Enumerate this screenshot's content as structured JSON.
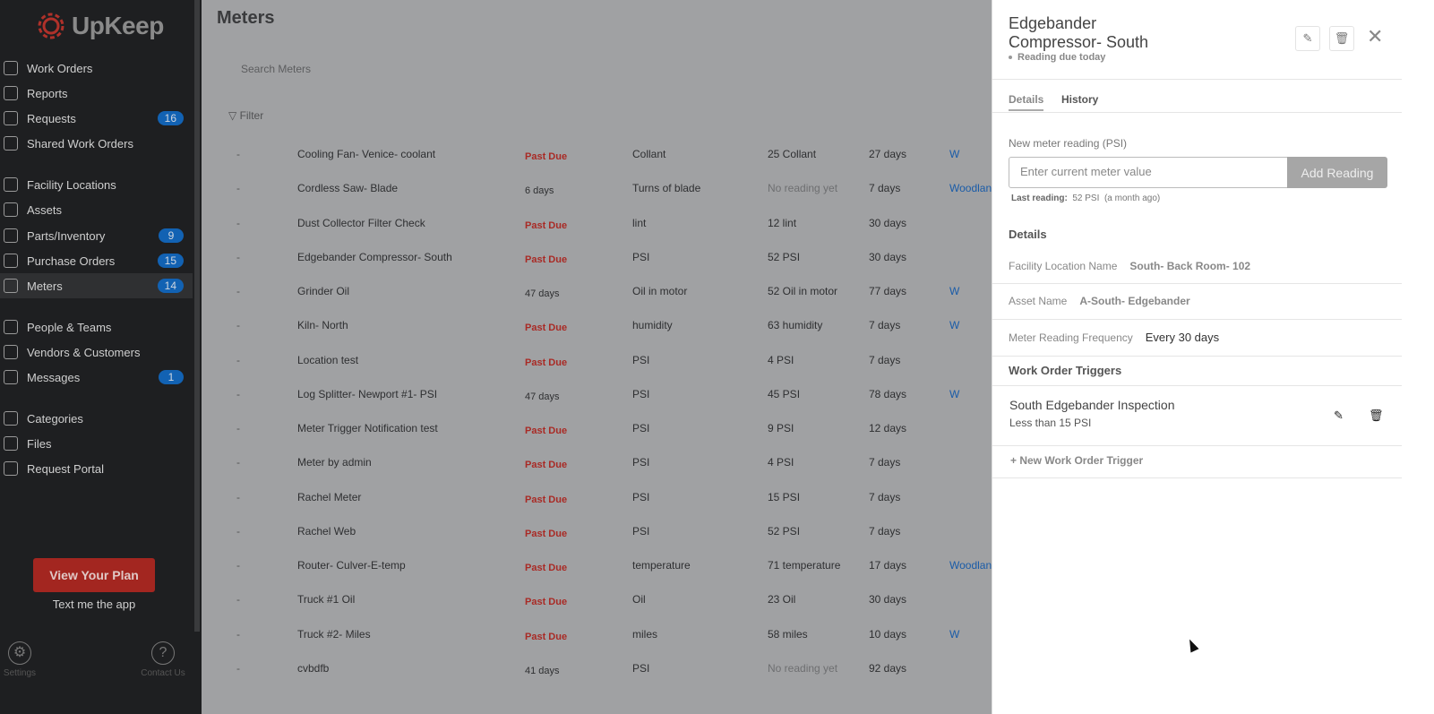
{
  "sidebar": {
    "brand": "UpKeep",
    "items": [
      {
        "label": "Work Orders"
      },
      {
        "label": "Reports"
      },
      {
        "label": "Requests",
        "badge": "16"
      },
      {
        "label": "Shared Work Orders"
      },
      {
        "label": "Facility Locations"
      },
      {
        "label": "Assets"
      },
      {
        "label": "Parts/Inventory",
        "badge": "9"
      },
      {
        "label": "Purchase Orders",
        "badge": "15"
      },
      {
        "label": "Meters",
        "badge": "14"
      },
      {
        "label": "People & Teams"
      },
      {
        "label": "Vendors & Customers"
      },
      {
        "label": "Messages",
        "badge": "1"
      },
      {
        "label": "Categories"
      },
      {
        "label": "Files"
      },
      {
        "label": "Request Portal"
      }
    ],
    "plan_button": "View Your Plan",
    "text_app": "Text me the app",
    "settings": "Settings",
    "contact": "Contact Us"
  },
  "main": {
    "title": "Meters",
    "search_placeholder": "Search Meters",
    "filter": "Filter",
    "rows": [
      {
        "dash": "-",
        "name": "Cooling Fan- Venice- coolant",
        "status": "Past Due",
        "unit": "Collant",
        "last": "25 Collant",
        "freq": "27 days",
        "loc": "W"
      },
      {
        "dash": "-",
        "name": "Cordless Saw- Blade",
        "status": "6 days",
        "unit": "Turns of blade",
        "last": "No reading yet",
        "freq": "7 days",
        "loc": "Woodlan"
      },
      {
        "dash": "-",
        "name": "Dust Collector Filter Check",
        "status": "Past Due",
        "unit": "lint",
        "last": "12 lint",
        "freq": "30 days",
        "loc": ""
      },
      {
        "dash": "-",
        "name": "Edgebander Compressor- South",
        "status": "Past Due",
        "unit": "PSI",
        "last": "52 PSI",
        "freq": "30 days",
        "loc": ""
      },
      {
        "dash": "-",
        "name": "Grinder Oil",
        "status": "47 days",
        "unit": "Oil in motor",
        "last": "52 Oil in motor",
        "freq": "77 days",
        "loc": "W"
      },
      {
        "dash": "-",
        "name": "Kiln- North",
        "status": "Past Due",
        "unit": "humidity",
        "last": "63 humidity",
        "freq": "7 days",
        "loc": "W"
      },
      {
        "dash": "-",
        "name": "Location test",
        "status": "Past Due",
        "unit": "PSI",
        "last": "4 PSI",
        "freq": "7 days",
        "loc": ""
      },
      {
        "dash": "-",
        "name": "Log Splitter- Newport #1- PSI",
        "status": "47 days",
        "unit": "PSI",
        "last": "45 PSI",
        "freq": "78 days",
        "loc": "W"
      },
      {
        "dash": "-",
        "name": "Meter Trigger Notification test",
        "status": "Past Due",
        "unit": "PSI",
        "last": "9 PSI",
        "freq": "12 days",
        "loc": ""
      },
      {
        "dash": "-",
        "name": "Meter by admin",
        "status": "Past Due",
        "unit": "PSI",
        "last": "4 PSI",
        "freq": "7 days",
        "loc": ""
      },
      {
        "dash": "-",
        "name": "Rachel Meter",
        "status": "Past Due",
        "unit": "PSI",
        "last": "15 PSI",
        "freq": "7 days",
        "loc": ""
      },
      {
        "dash": "-",
        "name": "Rachel Web",
        "status": "Past Due",
        "unit": "PSI",
        "last": "52 PSI",
        "freq": "7 days",
        "loc": ""
      },
      {
        "dash": "-",
        "name": "Router- Culver-E-temp",
        "status": "Past Due",
        "unit": "temperature",
        "last": "71 temperature",
        "freq": "17 days",
        "loc": "Woodlan"
      },
      {
        "dash": "-",
        "name": "Truck #1 Oil",
        "status": "Past Due",
        "unit": "Oil",
        "last": "23 Oil",
        "freq": "30 days",
        "loc": ""
      },
      {
        "dash": "-",
        "name": "Truck #2- Miles",
        "status": "Past Due",
        "unit": "miles",
        "last": "58 miles",
        "freq": "10 days",
        "loc": "W"
      },
      {
        "dash": "-",
        "name": "cvbdfb",
        "status": "41 days",
        "unit": "PSI",
        "last": "No reading yet",
        "freq": "92 days",
        "loc": ""
      }
    ]
  },
  "panel": {
    "title_line1": "Edgebander",
    "title_line2": "Compressor- South",
    "due": "Reading due today",
    "tabs": [
      "Details",
      "History"
    ],
    "reading_label": "New meter reading (PSI)",
    "input_placeholder": "Enter current meter value",
    "add_button": "Add Reading",
    "last_label": "Last reading:",
    "last_value": "52 PSI",
    "last_when": "(a month ago)",
    "details_heading": "Details",
    "facility_label": "Facility Location Name",
    "facility_value": "South- Back Room- 102",
    "asset_label": "Asset Name",
    "asset_value": "A-South- Edgebander",
    "freq_label": "Meter Reading Frequency",
    "freq_value": "Every 30 days",
    "triggers_heading": "Work Order Triggers",
    "trigger_name": "South Edgebander Inspection",
    "trigger_condition": "Less than 15 PSI",
    "new_trigger": "New Work Order Trigger"
  },
  "colors": {
    "accent_red": "#a32620",
    "badge_blue": "#1262b3",
    "past_due": "#a92a25",
    "link": "#1a5ca8"
  }
}
